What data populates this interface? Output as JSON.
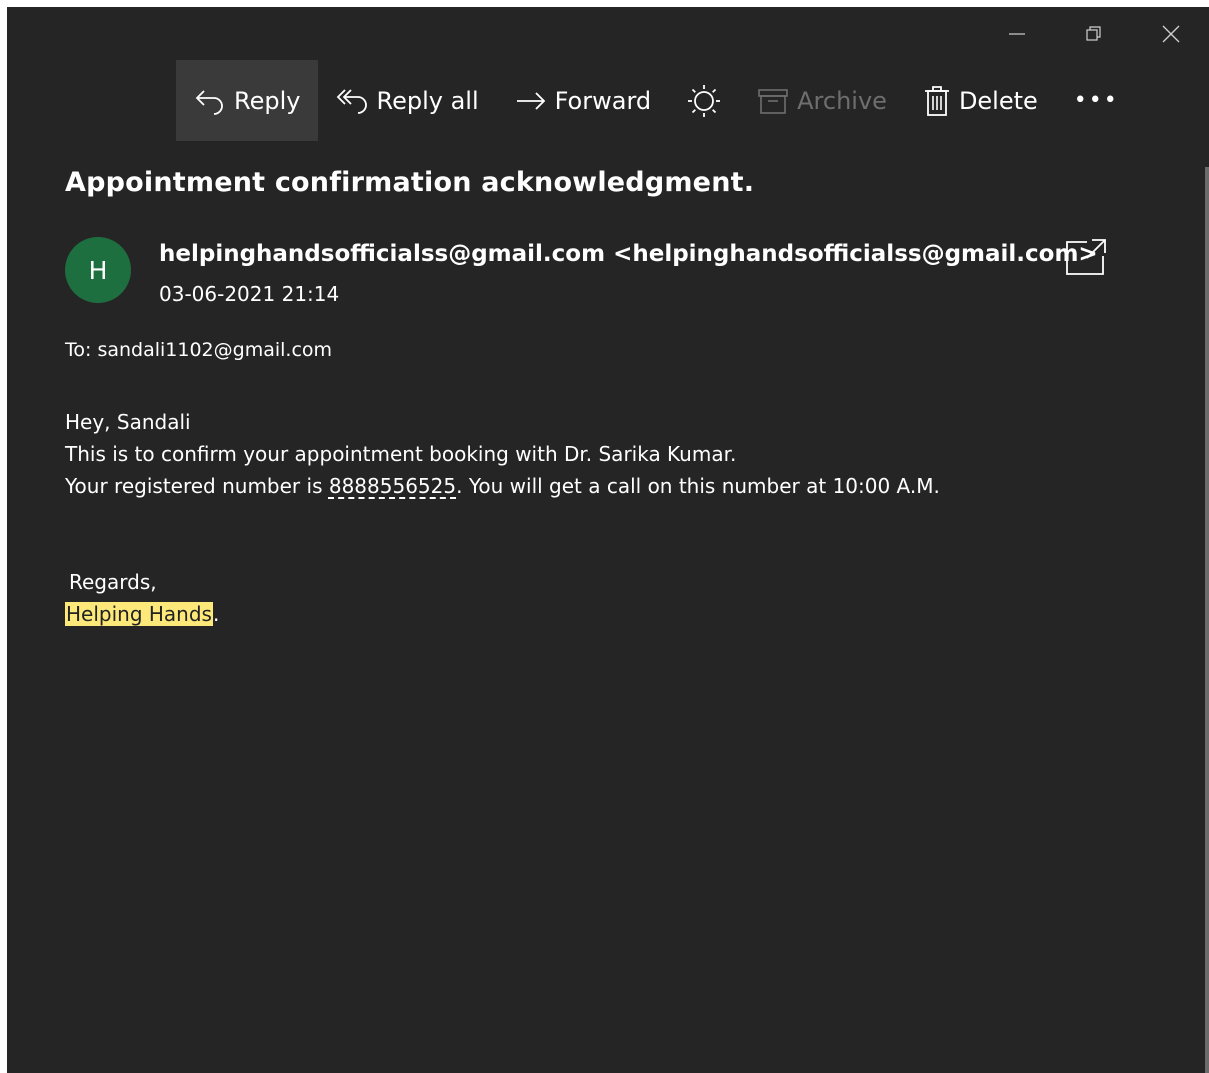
{
  "toolbar": {
    "reply": "Reply",
    "reply_all": "Reply all",
    "forward": "Forward",
    "archive": "Archive",
    "delete": "Delete",
    "more": "•••"
  },
  "icons": {
    "reply": "reply-arrow-icon",
    "reply_all": "reply-all-icon",
    "forward": "forward-arrow-icon",
    "theme": "sun-icon",
    "archive": "archive-box-icon",
    "delete": "trash-icon",
    "popout": "open-in-new-window-icon",
    "minimize": "minimize-icon",
    "restore": "restore-icon",
    "close": "close-icon"
  },
  "message": {
    "subject": "Appointment confirmation acknowledgment.",
    "avatar_initial": "H",
    "sender": "helpinghandsofficialss@gmail.com <helpinghandsofficialss@gmail.com>",
    "date": "03-06-2021 21:14",
    "to": "To: sandali1102@gmail.com",
    "greeting": "Hey, Sandali",
    "line1": "This is to confirm your appointment booking with Dr. Sarika Kumar.",
    "line2_prefix": "Your registered number is ",
    "phone": "8888556525",
    "line2_suffix": ". You will get a call on this number at 10:00 A.M.",
    "regards": "Regards,",
    "signature": "Helping Hands",
    "signature_suffix": "."
  },
  "colors": {
    "background": "#252525",
    "avatar": "#1e6f3f",
    "highlight": "#fde97a",
    "active_button": "#3a3a3a",
    "disabled_text": "#6e6e6e"
  }
}
